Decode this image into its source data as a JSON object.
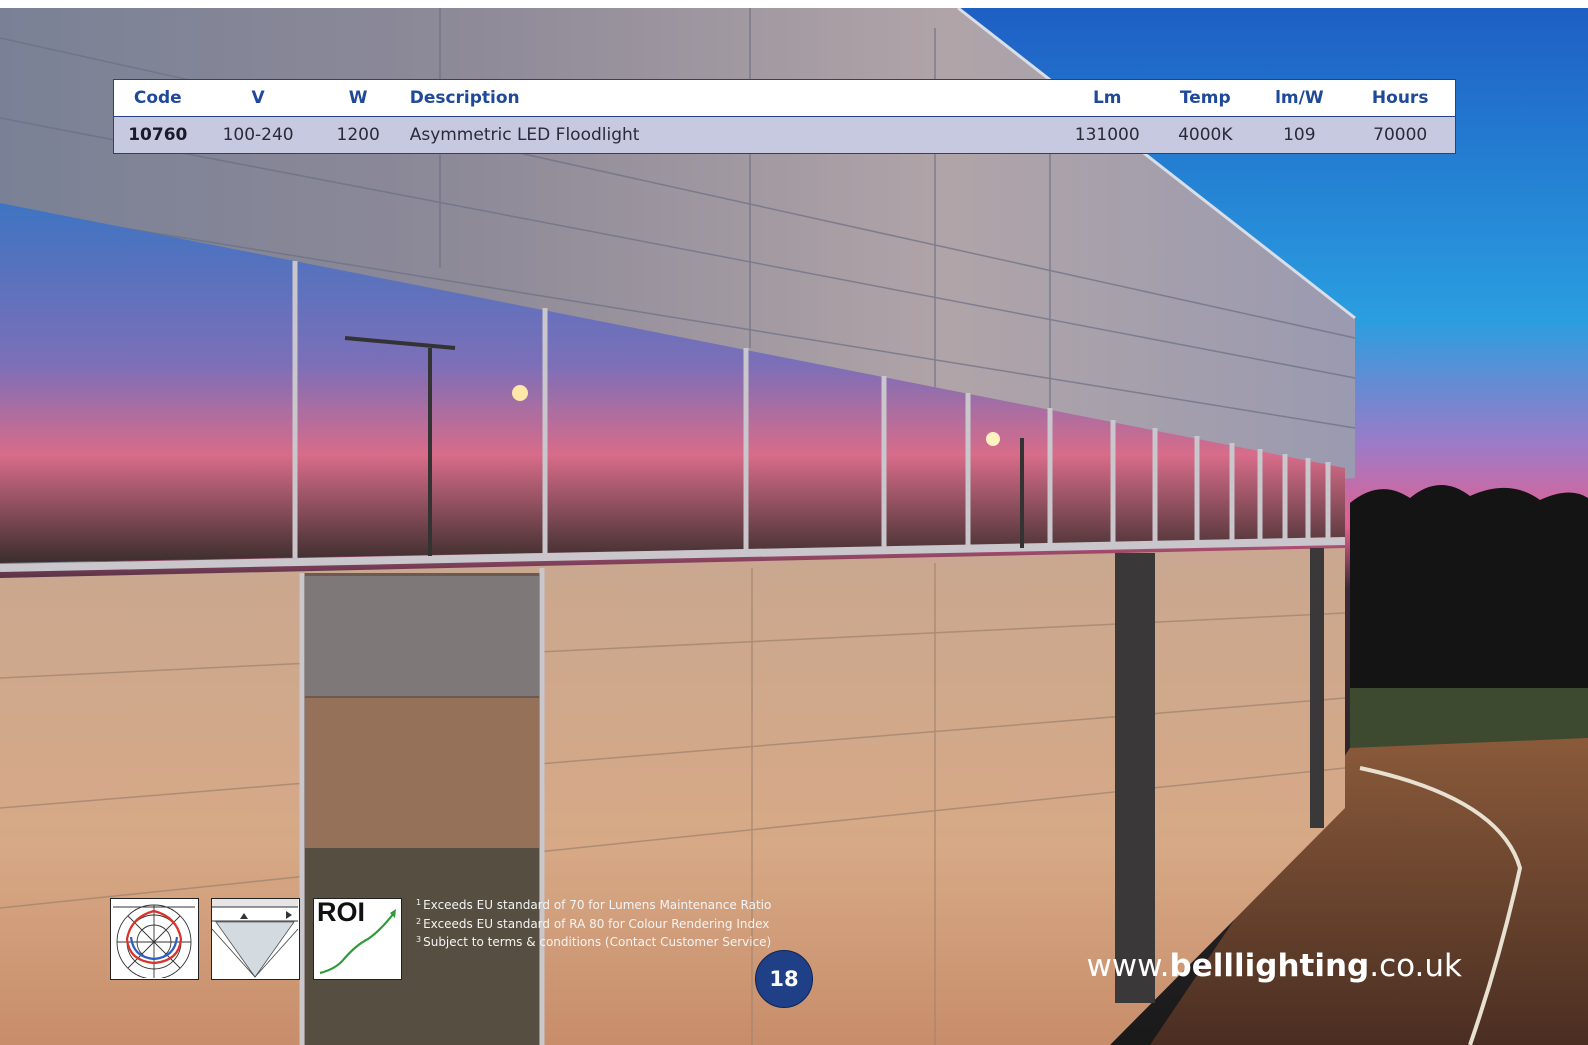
{
  "table": {
    "headers": {
      "code": "Code",
      "v": "V",
      "w": "W",
      "description": "Description",
      "lm": "Lm",
      "temp": "Temp",
      "lmw": "lm/W",
      "hours": "Hours"
    },
    "row": {
      "code": "10760",
      "v": "100-240",
      "w": "1200",
      "description": "Asymmetric LED Floodlight",
      "lm": "131000",
      "temp": "4000K",
      "lmw": "109",
      "hours": "70000"
    }
  },
  "icons": {
    "polar": "polar-distribution-icon",
    "beam": "beam-angle-icon",
    "roi": "roi-icon",
    "roi_label": "ROI"
  },
  "footnotes": [
    {
      "mark": "1",
      "text": "Exceeds EU standard of 70 for Lumens Maintenance Ratio"
    },
    {
      "mark": "2",
      "text": "Exceeds EU standard of RA 80 for Colour Rendering Index"
    },
    {
      "mark": "3",
      "text": "Subject to terms & conditions (Contact Customer Service)"
    }
  ],
  "page_number": "18",
  "website": {
    "prefix": "www.",
    "brand": "belllighting",
    "suffix": ".co.uk"
  },
  "colors": {
    "brand_blue": "#1f3f86",
    "table_row": "#c7c9e0",
    "header_text": "#1f4a9a"
  }
}
